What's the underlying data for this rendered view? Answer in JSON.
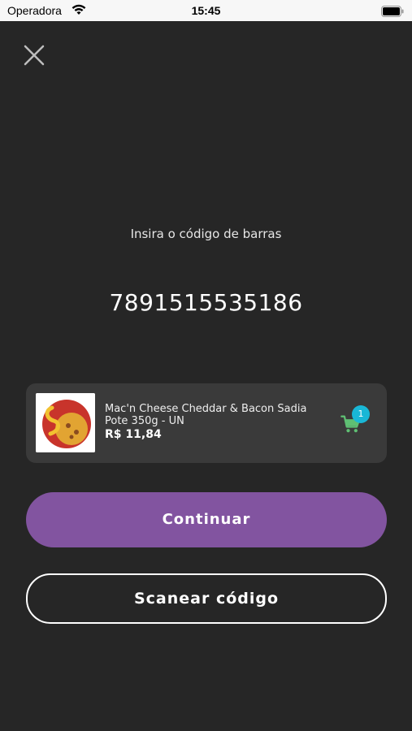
{
  "status_bar": {
    "carrier": "Operadora",
    "time": "15:45"
  },
  "screen": {
    "prompt": "Insira o código de barras",
    "barcode_value": "7891515535186"
  },
  "product": {
    "name": "Mac'n Cheese Cheddar & Bacon Sadia Pote 350g - UN",
    "price": "R$ 11,84",
    "cart_count": "1"
  },
  "buttons": {
    "continue_label": "Continuar",
    "scan_label": "Scanear código"
  },
  "colors": {
    "background": "#262626",
    "card": "#3a3a3a",
    "primary": "#8254a0",
    "cart_icon": "#5fbf73",
    "badge": "#19b7d6"
  }
}
